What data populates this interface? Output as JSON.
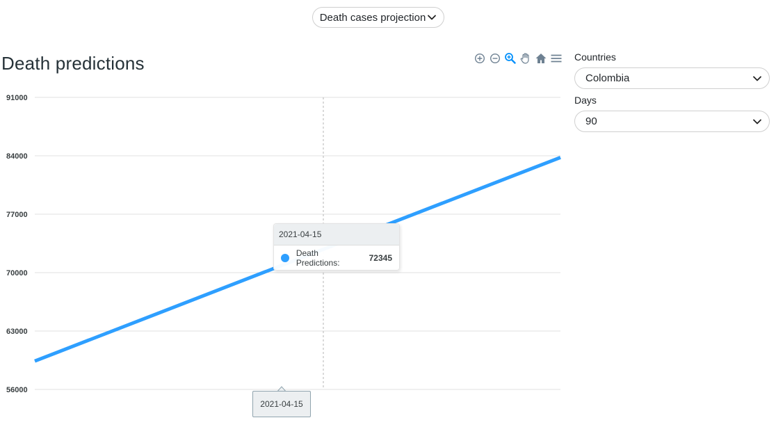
{
  "top_select": {
    "label": "Death cases projection",
    "icon": "chevron-down-icon"
  },
  "chart_data": {
    "type": "line",
    "title": "Death predictions",
    "y_ticks": [
      "91000",
      "84000",
      "77000",
      "70000",
      "63000",
      "56000"
    ],
    "ylim": [
      56000,
      91000
    ],
    "grid": true,
    "series": [
      {
        "name": "Death Predictions",
        "color": "#2e9fff",
        "start_value": 59400,
        "end_value": 83800
      }
    ]
  },
  "toolbar": {
    "icons": [
      "zoom-in-icon",
      "zoom-out-icon",
      "selection-zoom-icon",
      "pan-hand-icon",
      "reset-home-icon",
      "menu-icon"
    ]
  },
  "tooltip": {
    "date": "2021-04-15",
    "series_label": "Death Predictions:",
    "value": "72345"
  },
  "x_tooltip": {
    "date": "2021-04-15"
  },
  "filters": {
    "countries_label": "Countries",
    "country_value": "Colombia",
    "days_label": "Days",
    "days_value": "90"
  },
  "colors": {
    "line": "#2e9fff",
    "grid": "#e0e0e0",
    "accent": "#008ffb"
  }
}
